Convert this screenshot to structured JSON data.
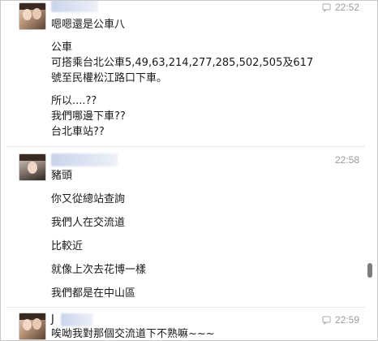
{
  "messages": [
    {
      "time": "22:52",
      "lines": [
        "嗯嗯還是公車八",
        "公車",
        "可搭乘台北公車5,49,63,214,277,285,502,505及617",
        "號至民權松江路口下車。",
        "所以....??",
        "我們哪邊下車??",
        "台北車站??"
      ]
    },
    {
      "time": "22:58",
      "lines": [
        "豬頭",
        "你又從總站查詢",
        "我們人在交流道",
        "比較近",
        "就像上次去花博一樣",
        "我們都是在中山區"
      ]
    },
    {
      "time": "22:59",
      "name_initial": "J",
      "lines": [
        "唉呦我對那個交流道下不熟嘛~~~"
      ]
    }
  ],
  "icons": {
    "reply": "reply-icon"
  },
  "colors": {
    "timestamp": "#9a9a9a",
    "separator": "#d2d2d2",
    "name_blur": "#c9d3ea"
  }
}
